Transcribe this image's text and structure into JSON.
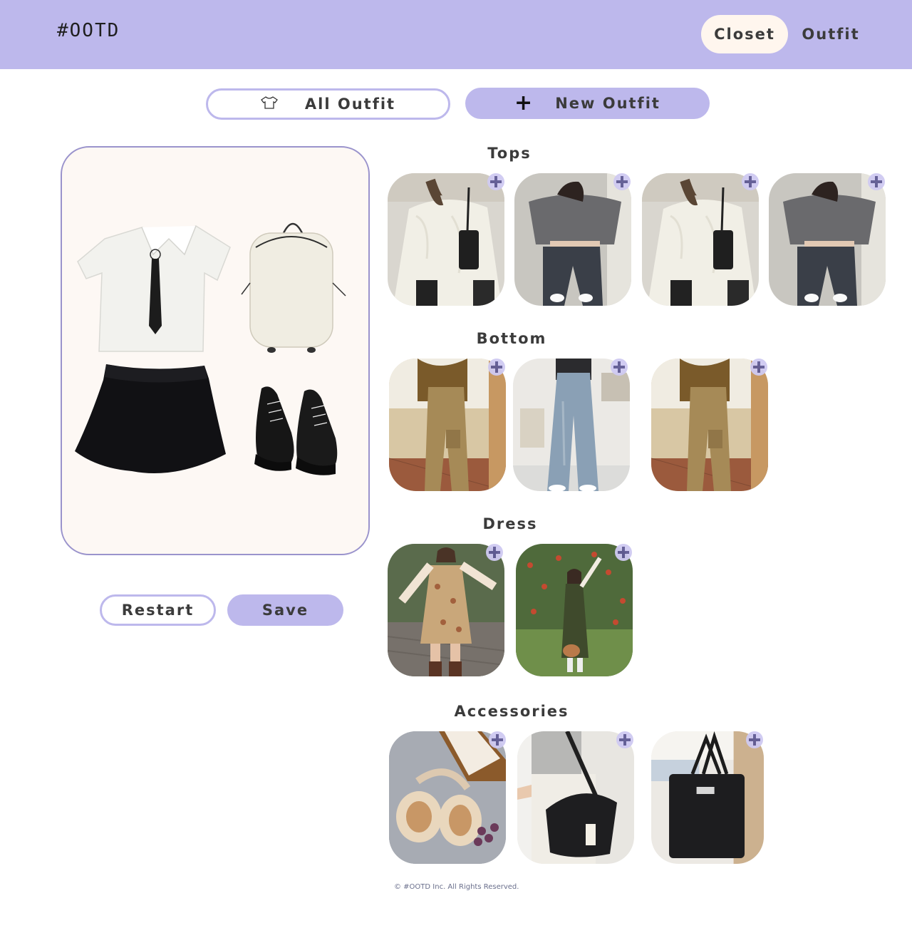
{
  "header": {
    "logo": "#OOTD",
    "nav": {
      "closet": "Closet",
      "outfit": "Outfit"
    },
    "accent_color": "#bdb8ec",
    "active_nav_bg": "#fff6ee"
  },
  "toolbar": {
    "all_outfit_label": "All Outfit",
    "all_outfit_icon": "tshirt-icon",
    "new_outfit_label": "New Outfit",
    "new_outfit_icon": "plus-icon"
  },
  "canvas": {
    "items": [
      "white-shirt-with-tie",
      "white-backpack",
      "black-skirt",
      "black-platform-shoes"
    ]
  },
  "actions": {
    "restart_label": "Restart",
    "save_label": "Save"
  },
  "sections": {
    "tops": {
      "title": "Tops",
      "items": [
        "cream-knit-sweater",
        "grey-off-shoulder-top",
        "cream-knit-sweater",
        "grey-off-shoulder-top"
      ]
    },
    "bottom": {
      "title": "Bottom",
      "items": [
        "khaki-cargo-pants",
        "light-wash-wide-jeans",
        "khaki-cargo-pants"
      ]
    },
    "dress": {
      "title": "Dress",
      "items": [
        "floral-slip-dress",
        "olive-pinafore-dress"
      ]
    },
    "accessories": {
      "title": "Accessories",
      "items": [
        "fluffy-earmuffs",
        "black-canvas-shoulder-bag",
        "black-tote-bag"
      ]
    }
  },
  "footer": {
    "copyright": "© #OOTD Inc. All Rights Reserved."
  }
}
